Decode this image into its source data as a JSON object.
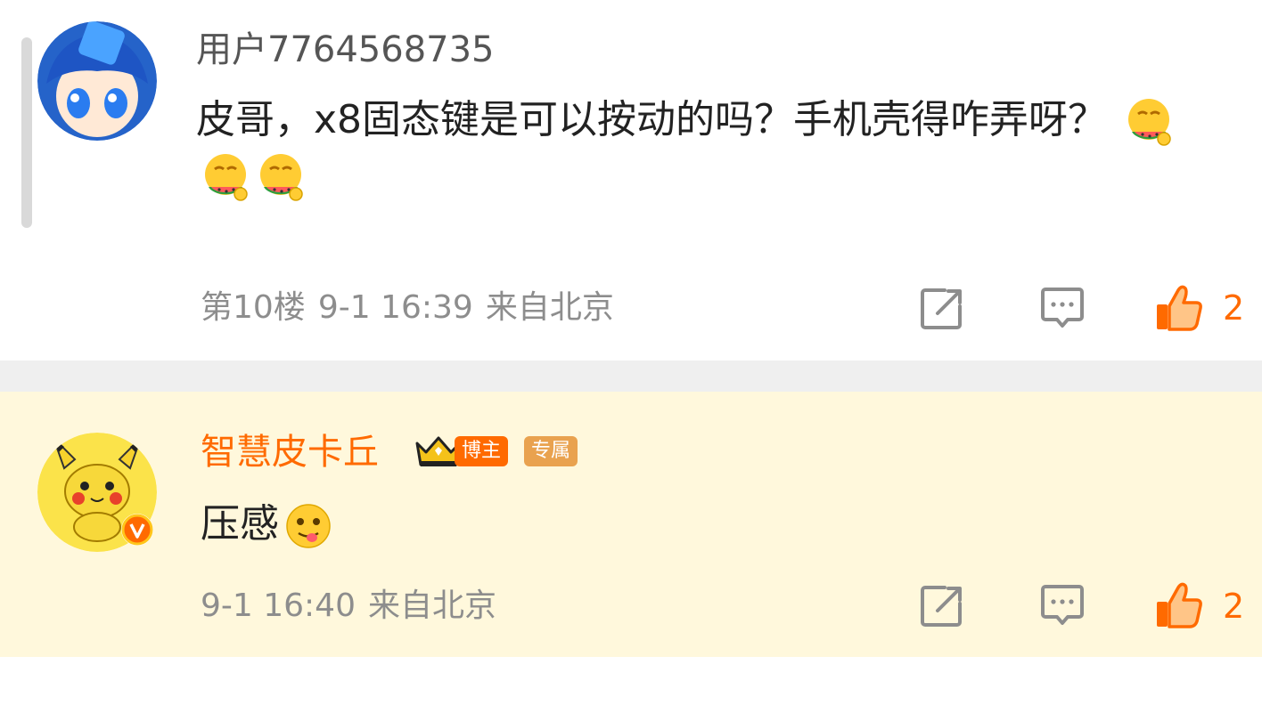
{
  "comments": [
    {
      "username": "用户7764568735",
      "text": "皮哥，x8固态键是可以按动的吗？手机壳得咋弄呀？",
      "emoji_count": 3,
      "emoji_icon": "watermelon-eating-emoji",
      "floor": "第10楼",
      "time": "9-1 16:39",
      "location": "来自北京",
      "like_count": "2"
    },
    {
      "username": "智慧皮卡丘",
      "badge_level_icon": "crown-level-2-icon",
      "tag_blogger": "博主",
      "tag_exclusive": "专属",
      "text": "压感",
      "emoji_icon": "tongue-out-emoji",
      "time": "9-1 16:40",
      "location": "来自北京",
      "like_count": "2",
      "verified": true
    }
  ],
  "icons": {
    "repost": "repost-icon",
    "reply": "reply-icon",
    "like": "thumbs-up-icon"
  },
  "colors": {
    "accent": "#ff6a00",
    "meta_gray": "#8d8d8d",
    "highlight_bg": "#fff8dc"
  }
}
